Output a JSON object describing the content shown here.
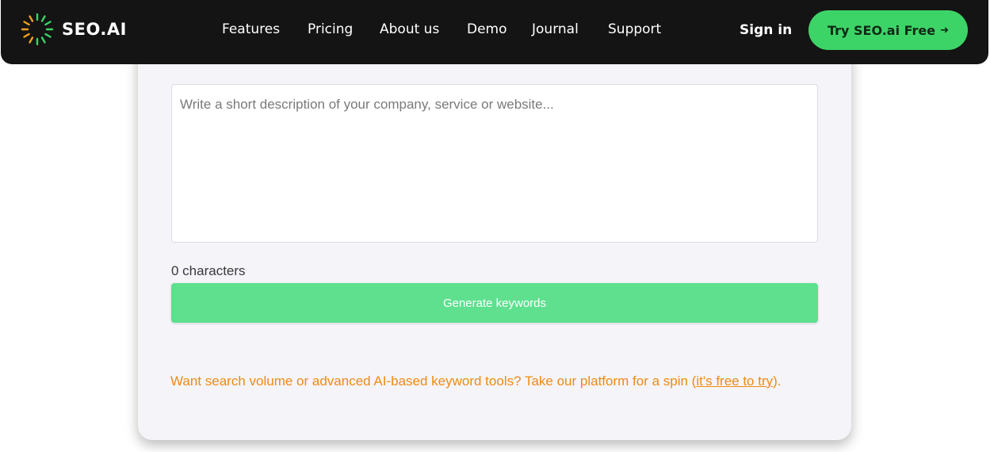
{
  "header": {
    "brand": "SEO.AI",
    "nav": [
      {
        "label": "Features"
      },
      {
        "label": "Pricing"
      },
      {
        "label": "About us"
      },
      {
        "label": "Demo"
      },
      {
        "label": "Journal"
      },
      {
        "label": "Support"
      }
    ],
    "sign_in": "Sign in",
    "cta_label": "Try SEO.ai Free",
    "cta_arrow": "➜"
  },
  "form": {
    "description_placeholder": "Write a short description of your company, service or website...",
    "description_value": "",
    "char_count": "0 characters",
    "generate_label": "Generate keywords"
  },
  "promo": {
    "text": "Want search volume or advanced AI-based keyword tools? Take our platform for a spin (",
    "link": "it's free to try",
    "suffix": ")."
  },
  "colors": {
    "nav_bg": "#141414",
    "accent_green": "#3dd467",
    "button_green": "#5ee08f",
    "promo_orange": "#f08a12",
    "card_bg": "#f4f4f9"
  }
}
